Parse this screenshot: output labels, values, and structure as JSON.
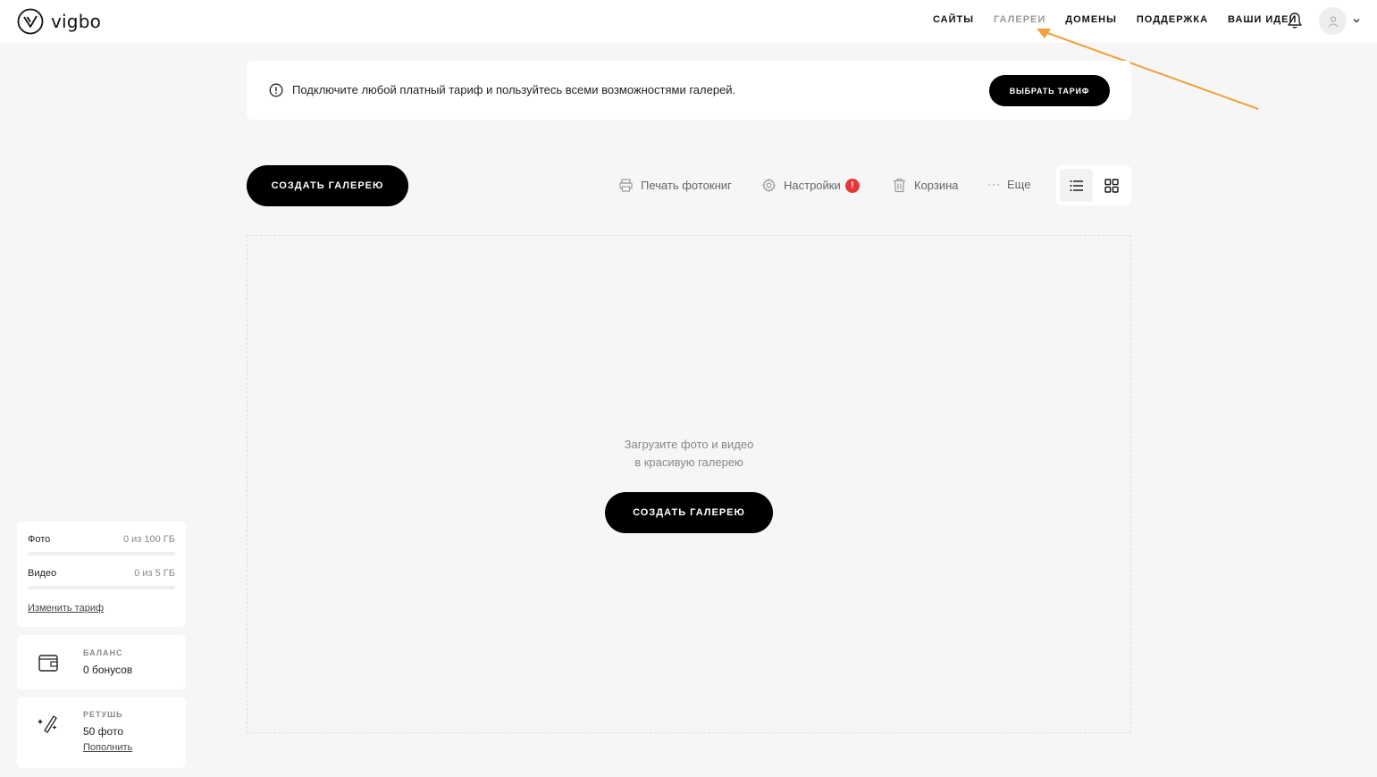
{
  "header": {
    "logo_text": "vigbo",
    "nav": [
      {
        "label": "САЙТЫ",
        "active": false
      },
      {
        "label": "ГАЛЕРЕИ",
        "active": true
      },
      {
        "label": "ДОМЕНЫ",
        "active": false
      },
      {
        "label": "ПОДДЕРЖКА",
        "active": false
      },
      {
        "label": "ВАШИ ИДЕИ",
        "active": false
      }
    ],
    "icons": {
      "notifications": "bell-icon",
      "user": "user-icon",
      "menu": "chevron-down-icon"
    }
  },
  "annotation": {
    "color": "#f0a03c"
  },
  "banner": {
    "text": "Подключите любой платный тариф и пользуйтесь всеми возможностями галерей.",
    "button_label": "ВЫБРАТЬ ТАРИФ"
  },
  "toolbar": {
    "create_label": "СОЗДАТЬ ГАЛЕРЕЮ",
    "print_label": "Печать фотокниг",
    "settings_label": "Настройки",
    "settings_badge": "!",
    "trash_label": "Корзина",
    "more_label": "Еще",
    "view_mode": "list"
  },
  "empty_state": {
    "line1": "Загрузите фото и видео",
    "line2": "в красивую галерею",
    "button_label": "СОЗДАТЬ ГАЛЕРЕЮ"
  },
  "storage": {
    "photo_label": "Фото",
    "photo_value": "0 из 100 ГБ",
    "photo_fraction": 0,
    "video_label": "Видео",
    "video_value": "0 из 5 ГБ",
    "video_fraction": 0,
    "change_plan_label": "Изменить тариф"
  },
  "balance": {
    "caption": "БАЛАНС",
    "value": "0 бонусов"
  },
  "retouch": {
    "caption": "РЕТУШЬ",
    "value": "50 фото",
    "link_label": "Пополнить"
  },
  "colors": {
    "accent": "#000000",
    "badge": "#e53939",
    "arrow": "#f0a03c"
  }
}
